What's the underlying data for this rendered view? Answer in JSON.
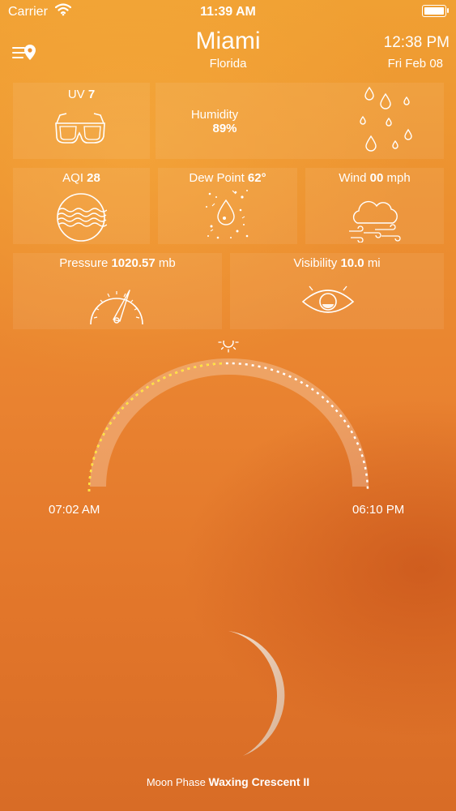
{
  "status_bar": {
    "carrier": "Carrier",
    "time": "11:39 AM"
  },
  "header": {
    "city": "Miami",
    "state": "Florida",
    "clock": "12:38 PM",
    "date": "Fri Feb 08",
    "menu_icon": "list-location-icon"
  },
  "tiles": {
    "uv": {
      "label": "UV",
      "value": "7",
      "icon": "3d-glasses-icon"
    },
    "humidity": {
      "label": "Humidity",
      "value": "89%",
      "icon": "raindrops-icon"
    },
    "aqi": {
      "label": "AQI",
      "value": "28",
      "icon": "air-waves-icon"
    },
    "dew_point": {
      "label": "Dew Point",
      "value": "62°",
      "icon": "dew-drop-icon"
    },
    "wind": {
      "label": "Wind",
      "value": "00",
      "unit": "mph",
      "icon": "wind-cloud-icon"
    },
    "pressure": {
      "label": "Pressure",
      "value": "1020.57",
      "unit": "mb",
      "icon": "gauge-icon"
    },
    "visibility": {
      "label": "Visibility",
      "value": "10.0",
      "unit": "mi",
      "icon": "eye-icon"
    }
  },
  "sun": {
    "sunrise": "07:02 AM",
    "sunset": "06:10 PM",
    "day_progress": 0.5,
    "icon": "sun-icon"
  },
  "moon": {
    "label": "Moon Phase",
    "phase": "Waxing Crescent II",
    "icon": "crescent-moon-icon"
  },
  "colors": {
    "bg_top": "#f0a033",
    "bg_bottom": "#d86c26",
    "arc_elapsed": "#ffe23a",
    "arc_remaining": "#ffffff"
  }
}
